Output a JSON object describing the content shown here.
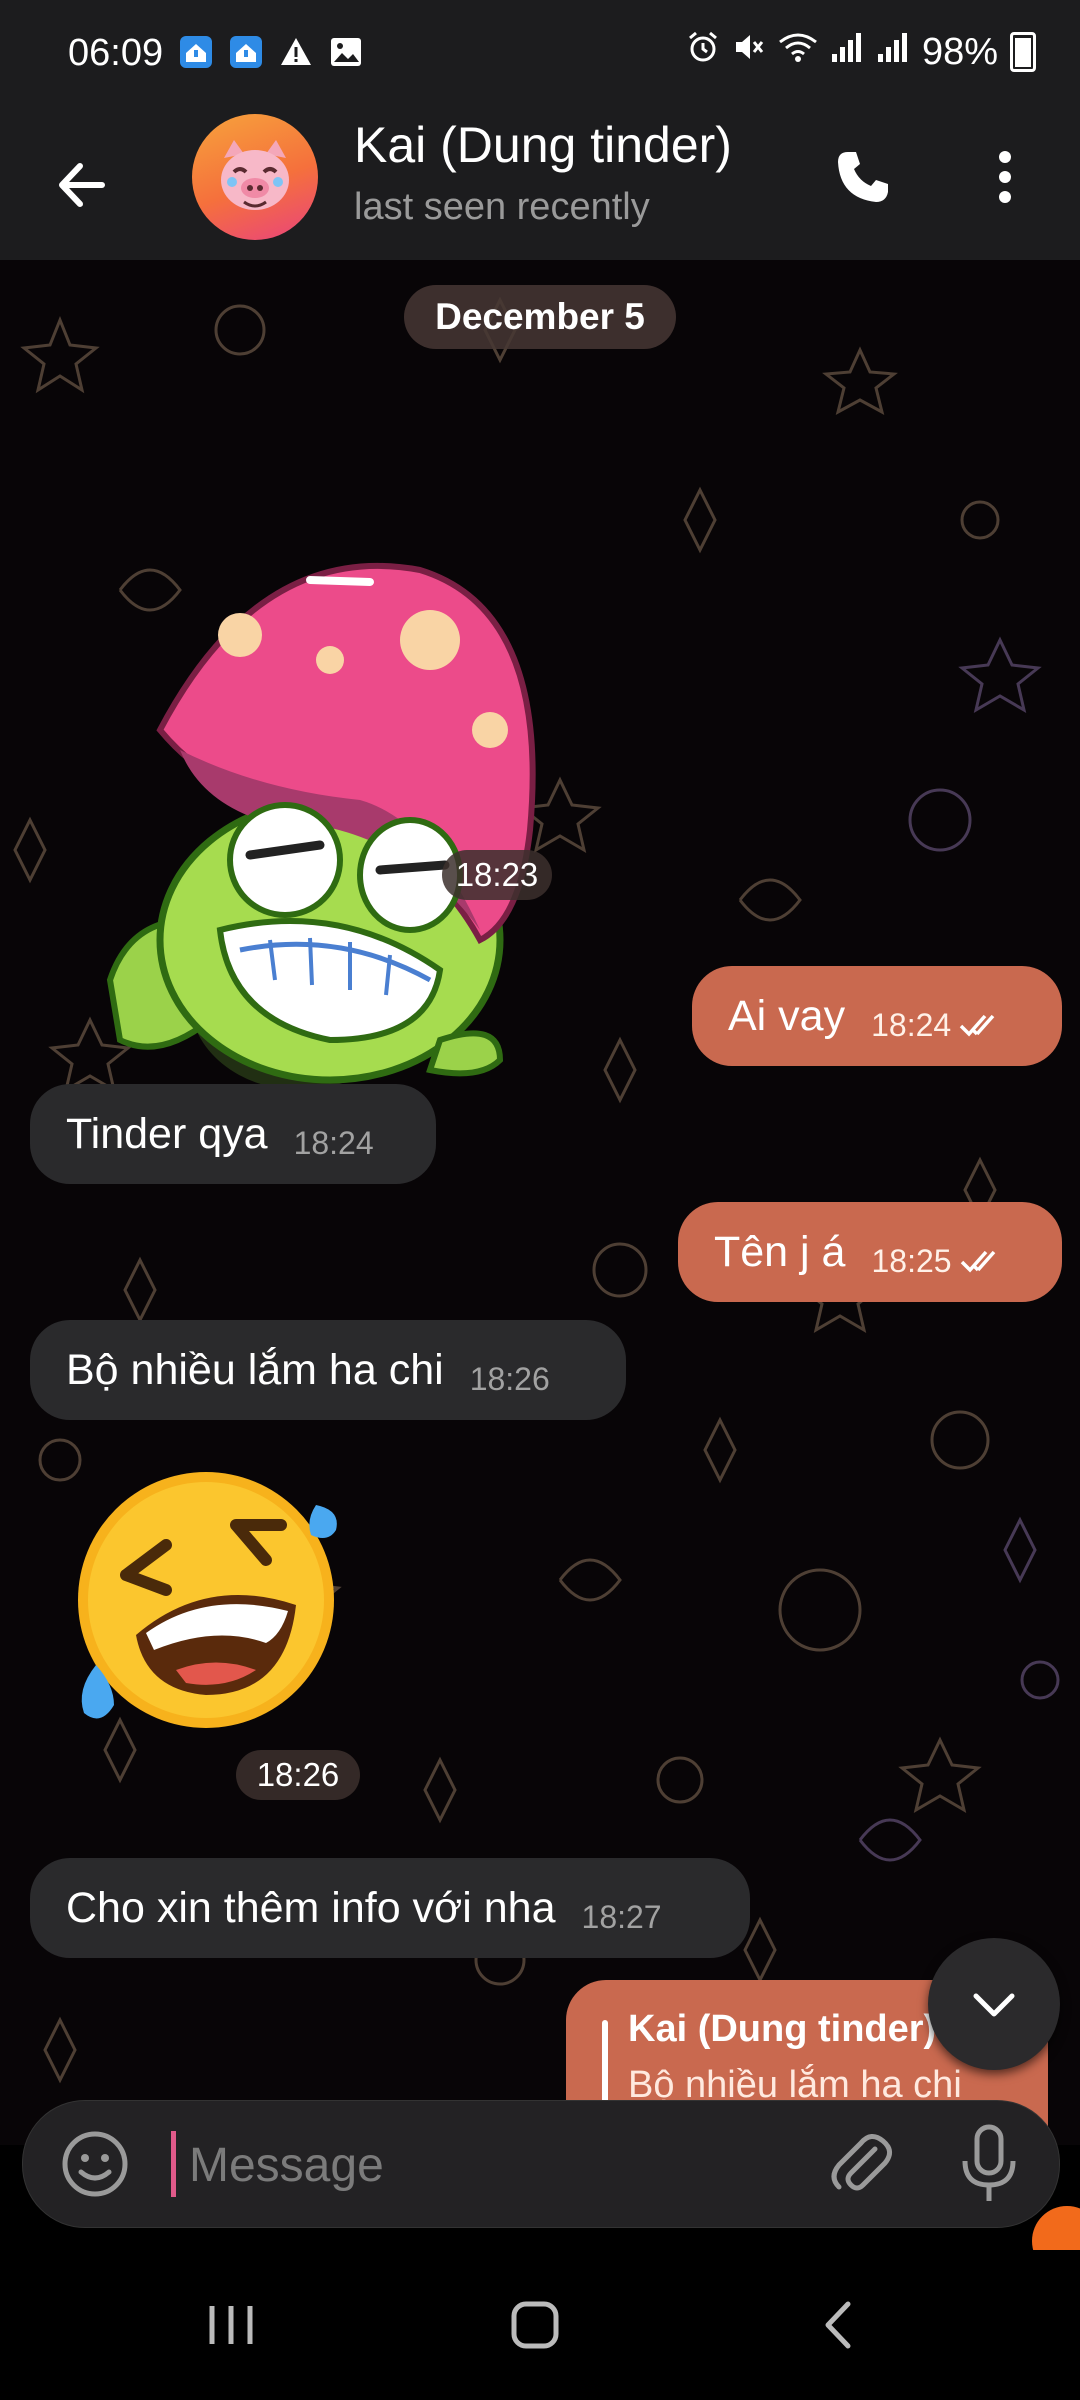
{
  "status_bar": {
    "time": "06:09",
    "left_icons": [
      "home-alert-icon",
      "home-alert-icon",
      "warning-icon",
      "image-icon"
    ],
    "right_icons": [
      "alarm-icon",
      "mute-icon",
      "wifi-icon",
      "signal-icon",
      "signal-icon"
    ],
    "battery": "98%"
  },
  "header": {
    "title": "Kai (Dung tinder)",
    "subtitle": "last seen recently"
  },
  "chat": {
    "date": "December 5",
    "messages": [
      {
        "kind": "sticker",
        "sticker": "mushroom-frog-sticker",
        "time": "18:23"
      },
      {
        "kind": "text",
        "direction": "out",
        "text": "Ai vay",
        "time": "18:24",
        "read": true
      },
      {
        "kind": "text",
        "direction": "in",
        "text": "Tinder qya",
        "time": "18:24"
      },
      {
        "kind": "text",
        "direction": "out",
        "text": "Tên j á",
        "time": "18:25",
        "read": true
      },
      {
        "kind": "text",
        "direction": "in",
        "text": "Bộ nhiều lắm ha chi",
        "time": "18:26"
      },
      {
        "kind": "sticker",
        "sticker": "laughing-emoji-sticker",
        "time": "18:26"
      },
      {
        "kind": "text",
        "direction": "in",
        "text": "Cho xin thêm info với nha",
        "time": "18:27"
      },
      {
        "kind": "reply",
        "direction": "out",
        "reply_name": "Kai (Dung tinder)",
        "reply_text": "Bộ nhiều lắm ha chi"
      }
    ]
  },
  "composer": {
    "placeholder": "Message"
  },
  "colors": {
    "header_bg": "#1c1c1e",
    "incoming_bubble": "#2a2a2c",
    "outgoing_bubble": "#c9694f",
    "caret": "#e05a8a"
  }
}
